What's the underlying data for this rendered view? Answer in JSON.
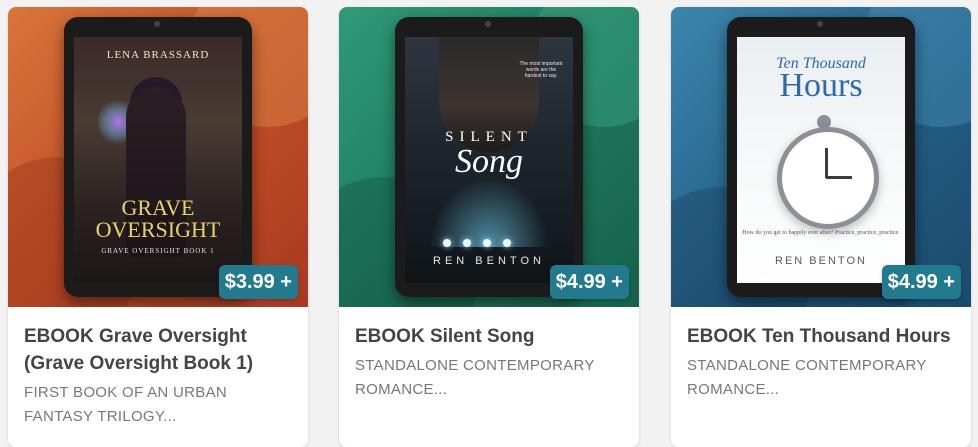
{
  "products": [
    {
      "title": "EBOOK Grave Oversight (Grave Oversight Book 1)",
      "description": "FIRST BOOK OF AN URBAN FANTASY TRILOGY...",
      "price": "$3.99 +",
      "cover": {
        "author": "LENA BRASSARD",
        "title_line1": "GRAVE",
        "title_line2": "OVERSIGHT",
        "subtitle": "GRAVE OVERSIGHT BOOK 1"
      },
      "background_color": "#c4532a"
    },
    {
      "title": "EBOOK Silent Song",
      "description": "STANDALONE CONTEMPORARY ROMANCE...",
      "price": "$4.99 +",
      "cover": {
        "tagline": "The most important words are the hardest to say.",
        "title_line1": "SILENT",
        "title_line2": "Song",
        "author": "REN BENTON"
      },
      "background_color": "#1f7a5d"
    },
    {
      "title": "EBOOK Ten Thousand Hours",
      "description": "STANDALONE CONTEMPORARY ROMANCE...",
      "price": "$4.99 +",
      "cover": {
        "title_line1": "Ten Thousand",
        "title_line2": "Hours",
        "quote": "How do you get to happily ever after? Practice, practice, practice.",
        "author": "REN BENTON"
      },
      "background_color": "#245e86"
    }
  ],
  "colors": {
    "price_badge": "#227a8f",
    "page_background": "#f2f2f2"
  }
}
